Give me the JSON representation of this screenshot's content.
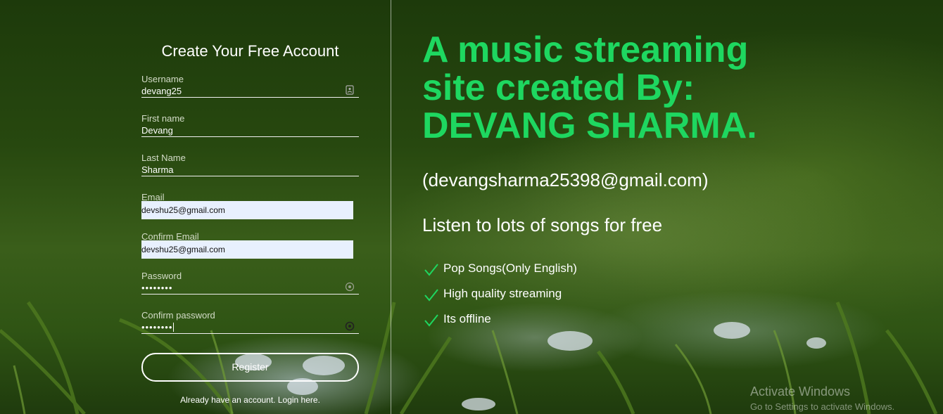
{
  "signup_form": {
    "title": "Create Your Free Account",
    "fields": [
      {
        "label": "Username",
        "value": "devang25",
        "icon": "contact-card-icon"
      },
      {
        "label": "First name",
        "value": "Devang"
      },
      {
        "label": "Last Name",
        "value": "Sharma"
      },
      {
        "label": "Email",
        "value": "devshu25@gmail.com"
      },
      {
        "label": "Confirm Email",
        "value": "devshu25@gmail.com"
      },
      {
        "label": "Password",
        "value": "••••••••",
        "icon": "password-reveal-icon"
      },
      {
        "label": "Confirm password",
        "value": "••••••••",
        "icon": "password-reveal-icon"
      }
    ],
    "register_label": "Register",
    "login_link": "Already have an account. Login here."
  },
  "hero": {
    "title_lines": [
      "A music streaming",
      "site created By:",
      "DEVANG SHARMA."
    ],
    "contact": "(devangsharma25398@gmail.com)",
    "tagline": "Listen to lots of songs for free",
    "features": [
      "Pop Songs(Only English)",
      "High quality streaming",
      "Its offline"
    ],
    "check_icon": "checkmark-icon"
  },
  "watermark": {
    "title": "Activate Windows",
    "subtitle": "Go to Settings to activate Windows."
  },
  "colors": {
    "accent_green": "#1ed760",
    "autofill_bg": "#e8f0fe"
  }
}
